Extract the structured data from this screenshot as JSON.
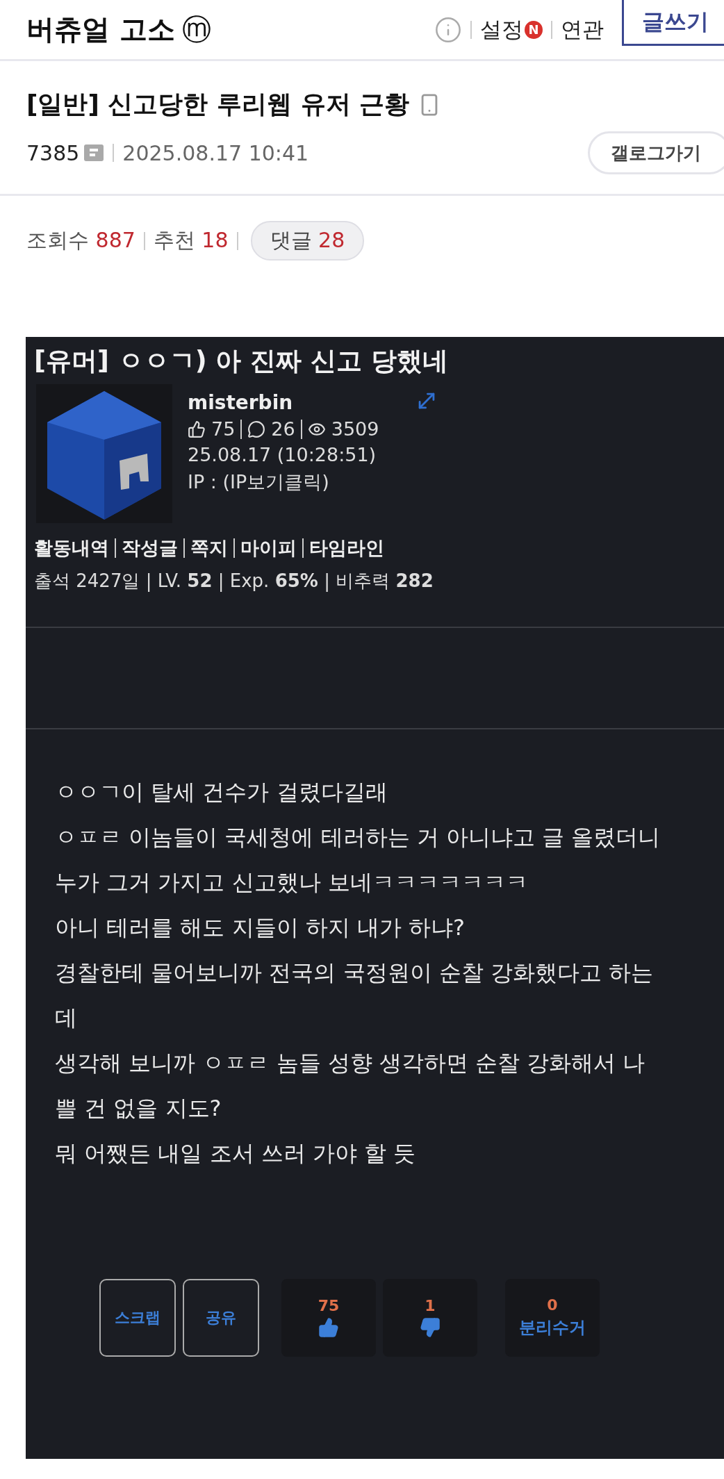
{
  "header": {
    "title": "버츄얼 고소",
    "mark": "ⓜ",
    "links": [
      {
        "label": "설정",
        "badge": "N"
      },
      {
        "label": "연관"
      }
    ],
    "write_button": "글쓰기"
  },
  "post": {
    "category": "[일반]",
    "title": "신고당한 루리웹 유저 근황",
    "author": "7385",
    "date": "2025.08.17 10:41",
    "gallog_button": "갤로그가기",
    "stats": [
      {
        "label": "조회수",
        "value": "887",
        "kind": "plain"
      },
      {
        "label": "추천",
        "value": "18",
        "kind": "plain"
      },
      {
        "label": "댓글",
        "value": "28",
        "kind": "pill"
      }
    ]
  },
  "screenshot": {
    "title": "[유머] ㅇㅇㄱ) 아 진짜 신고 당했네",
    "username": "misterbin",
    "likes": "75",
    "comments": "26",
    "views": "3509",
    "datetime": "25.08.17 (10:28:51)",
    "ip": "IP : (IP보기클릭)",
    "profile_links": [
      "활동내역",
      "작성글",
      "쪽지",
      "마이피",
      "타임라인"
    ],
    "profile_stats": "출석 2427일 |  LV. **52**  | Exp. **65%** | 비추력 **282**",
    "body": [
      "ㅇㅇㄱ이 탈세 건수가 걸렸다길래",
      "ㅇㅍㄹ 이놈들이 국세청에 테러하는 거 아니냐고 글 올렸더니",
      "누가 그거 가지고 신고했나 보네ㅋㅋㅋㅋㅋㅋㅋ",
      "아니 테러를 해도 지들이 하지 내가 하냐?",
      "경찰한테 물어보니까 전국의 국정원이 순찰 강화했다고 하는데",
      "생각해 보니까 ㅇㅍㄹ 놈들 성향 생각하면 순찰 강화해서 나쁠 건 없을 지도?",
      "뭐 어쨌든 내일 조서 쓰러 가야 할 듯"
    ],
    "actions": [
      {
        "kind": "outline",
        "label": "스크랩"
      },
      {
        "kind": "outline",
        "label": "공유"
      },
      {
        "kind": "up",
        "count": "75"
      },
      {
        "kind": "down",
        "count": "1"
      },
      {
        "kind": "text",
        "count": "0",
        "label": "분리수거"
      }
    ]
  }
}
